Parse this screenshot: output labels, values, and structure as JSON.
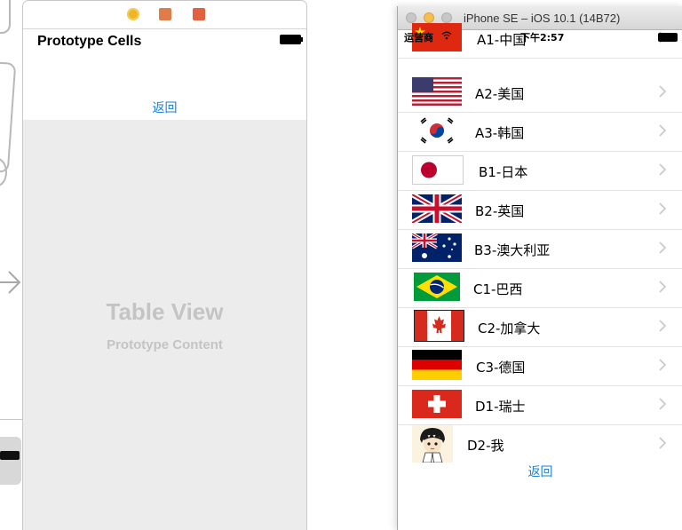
{
  "storyboard": {
    "scene_title": "Prototype Cells",
    "back_label": "返回",
    "table_view_title": "Table View",
    "table_view_subtitle": "Prototype Content",
    "dock_icons": [
      "view-controller-icon",
      "first-responder-icon",
      "exit-icon"
    ]
  },
  "simulator": {
    "window_title": "iPhone SE – iOS 10.1 (14B72)",
    "status_bar": {
      "carrier": "运营商",
      "time": "下午2:57"
    },
    "rows": [
      {
        "label": "A1-中国",
        "flag": "china-flag-icon"
      },
      {
        "label": "A2-美国",
        "flag": "usa-flag-icon"
      },
      {
        "label": "A3-韩国",
        "flag": "korea-flag-icon"
      },
      {
        "label": "B1-日本",
        "flag": "japan-flag-icon"
      },
      {
        "label": "B2-英国",
        "flag": "uk-flag-icon"
      },
      {
        "label": "B3-澳大利亚",
        "flag": "australia-flag-icon"
      },
      {
        "label": "C1-巴西",
        "flag": "brazil-flag-icon"
      },
      {
        "label": "C2-加拿大",
        "flag": "canada-flag-icon"
      },
      {
        "label": "C3-德国",
        "flag": "germany-flag-icon"
      },
      {
        "label": "D1-瑞士",
        "flag": "switzerland-flag-icon"
      },
      {
        "label": "D2-我",
        "flag": "avatar-cartoon-icon"
      }
    ],
    "back_label": "返回"
  },
  "colors": {
    "ios_tint": "#1a7fd6",
    "placeholder_text": "#c4c4c4",
    "table_view_bg": "#ececec"
  }
}
